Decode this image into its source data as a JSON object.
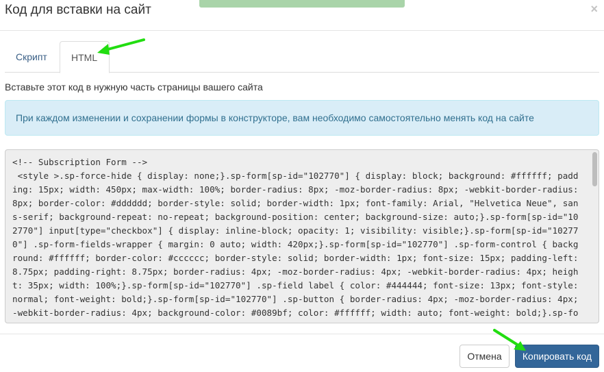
{
  "modal": {
    "title": "Код для вставки на сайт",
    "close_glyph": "×"
  },
  "tabs": [
    {
      "label": "Скрипт",
      "active": false
    },
    {
      "label": "HTML",
      "active": true
    }
  ],
  "instruction": "Вставьте этот код в нужную часть страницы вашего сайта",
  "alert": {
    "text": "При каждом изменении и сохранении формы в конструкторе, вам необходимо самостоятельно менять код на сайте"
  },
  "code": {
    "content": "<!-- Subscription Form -->\n <style >.sp-force-hide { display: none;}.sp-form[sp-id=\"102770\"] { display: block; background: #ffffff; padding: 15px; width: 450px; max-width: 100%; border-radius: 8px; -moz-border-radius: 8px; -webkit-border-radius: 8px; border-color: #dddddd; border-style: solid; border-width: 1px; font-family: Arial, \"Helvetica Neue\", sans-serif; background-repeat: no-repeat; background-position: center; background-size: auto;}.sp-form[sp-id=\"102770\"] input[type=\"checkbox\"] { display: inline-block; opacity: 1; visibility: visible;}.sp-form[sp-id=\"102770\"] .sp-form-fields-wrapper { margin: 0 auto; width: 420px;}.sp-form[sp-id=\"102770\"] .sp-form-control { background: #ffffff; border-color: #cccccc; border-style: solid; border-width: 1px; font-size: 15px; padding-left: 8.75px; padding-right: 8.75px; border-radius: 4px; -moz-border-radius: 4px; -webkit-border-radius: 4px; height: 35px; width: 100%;}.sp-form[sp-id=\"102770\"] .sp-field label { color: #444444; font-size: 13px; font-style: normal; font-weight: bold;}.sp-form[sp-id=\"102770\"] .sp-button { border-radius: 4px; -moz-border-radius: 4px; -webkit-border-radius: 4px; background-color: #0089bf; color: #ffffff; width: auto; font-weight: bold;}.sp-form[sp-id=\"102770\"] .sp-button-container { text-align: left;}"
  },
  "footer": {
    "cancel_label": "Отмена",
    "copy_label": "Копировать код"
  },
  "colors": {
    "primary_button": "#336699",
    "alert_bg": "#d9edf7",
    "alert_text": "#31708f",
    "annotation_arrow": "#22dd11"
  }
}
